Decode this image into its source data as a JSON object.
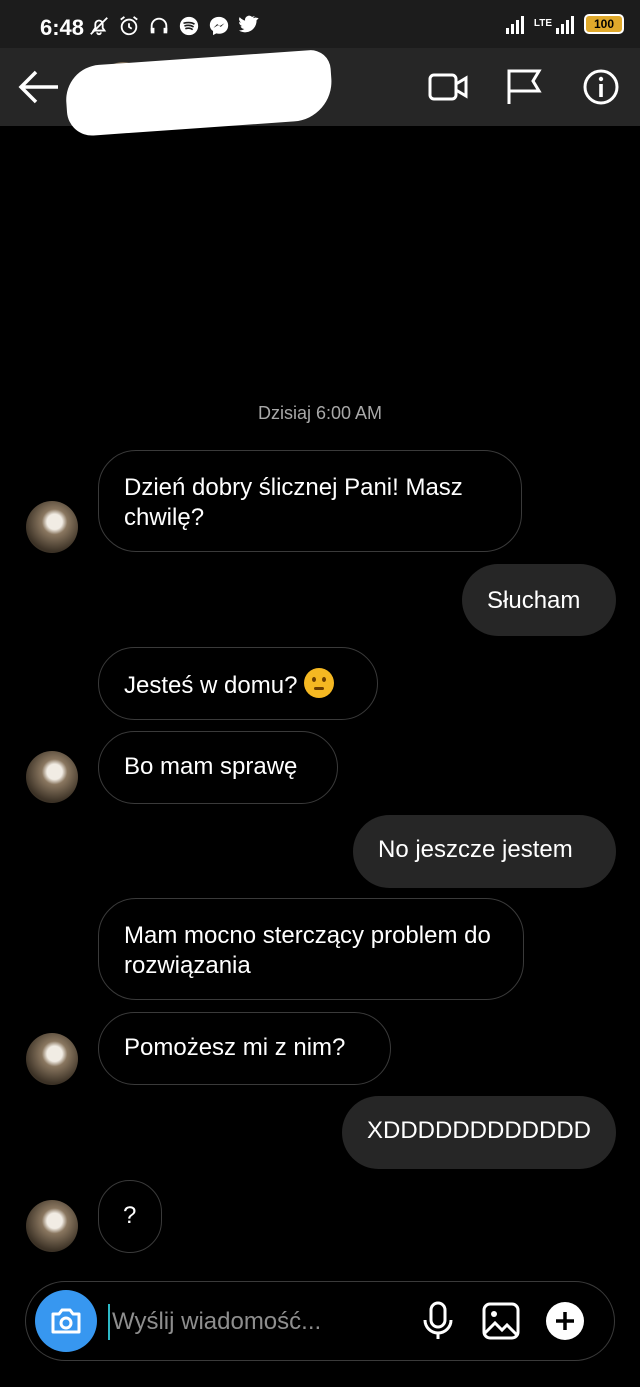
{
  "status_bar": {
    "time": "6:48",
    "network": "LTE",
    "battery": "100",
    "left_icons": [
      "bell-off-icon",
      "alarm-icon",
      "headphones-icon",
      "spotify-icon",
      "messenger-icon",
      "twitter-icon"
    ]
  },
  "header": {
    "contact_name_redacted": true,
    "icons": [
      "back-arrow-icon",
      "video-call-icon",
      "flag-icon",
      "info-icon"
    ]
  },
  "conversation": {
    "date_label": "Dzisiaj 6:00 AM",
    "messages": [
      {
        "side": "incoming",
        "text": "Dzień dobry ślicznej Pani! Masz chwilę?"
      },
      {
        "side": "outgoing",
        "text": "Słucham"
      },
      {
        "side": "incoming",
        "text": "Jesteś w domu?",
        "emoji": "thinking-face"
      },
      {
        "side": "incoming",
        "text": "Bo mam sprawę"
      },
      {
        "side": "outgoing",
        "text": "No jeszcze jestem"
      },
      {
        "side": "incoming",
        "text": "Mam mocno sterczący problem do rozwiązania"
      },
      {
        "side": "incoming",
        "text": "Pomożesz mi z nim?"
      },
      {
        "side": "outgoing",
        "text": "XDDDDDDDDDDDD"
      },
      {
        "side": "incoming",
        "text": "?"
      }
    ]
  },
  "composer": {
    "placeholder": "Wyślij wiadomość...",
    "icons": [
      "camera-icon",
      "microphone-icon",
      "image-icon",
      "plus-icon"
    ]
  },
  "colors": {
    "background": "#000000",
    "header_bg": "#262626",
    "outgoing_bubble": "#262626",
    "accent": "#3797f0",
    "battery": "#e0a92b"
  }
}
